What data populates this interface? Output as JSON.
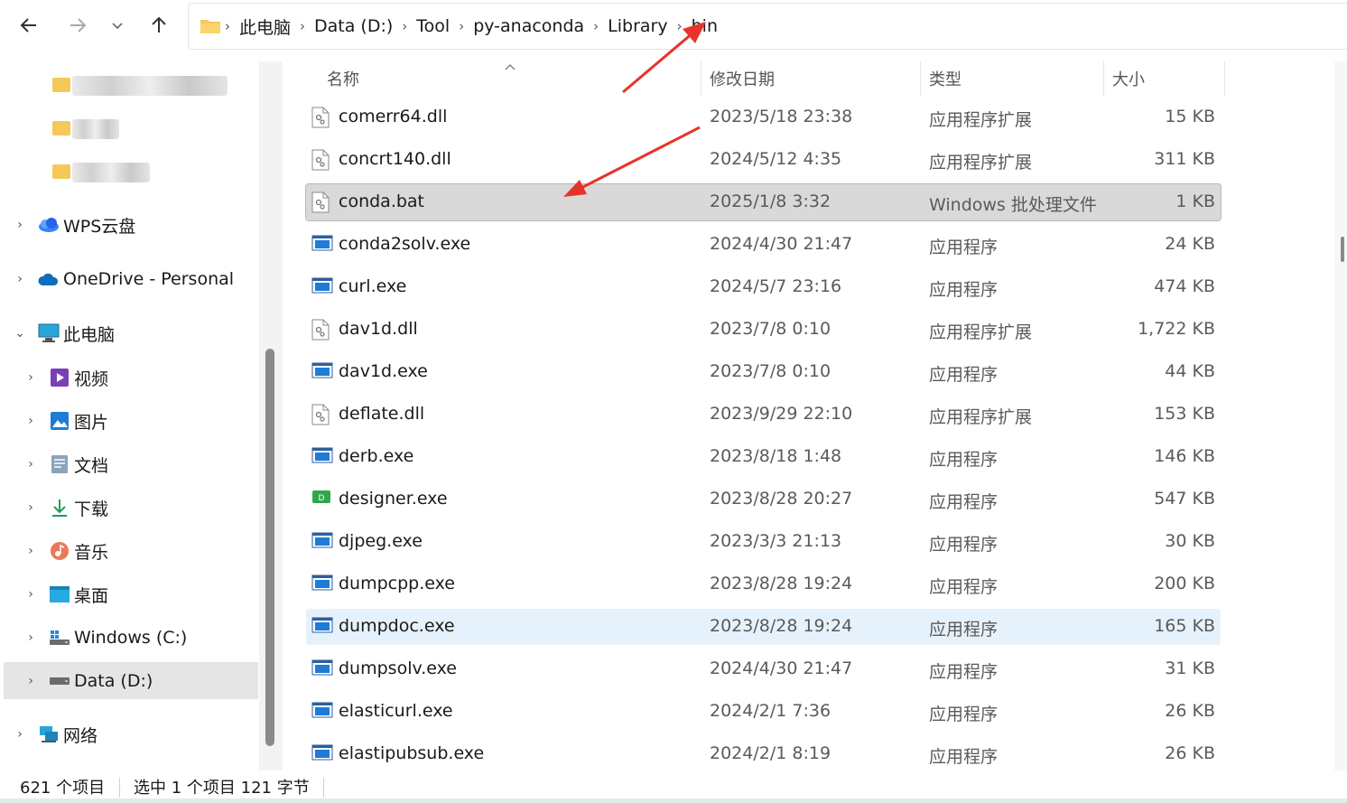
{
  "nav": {
    "back_icon": "arrow-left-icon",
    "forward_icon": "arrow-right-icon",
    "recent_icon": "chevron-down-icon",
    "up_icon": "arrow-up-icon"
  },
  "address": {
    "crumbs": [
      "此电脑",
      "Data (D:)",
      "Tool",
      "py-anaconda",
      "Library",
      "bin"
    ]
  },
  "sidebar": {
    "items": [
      {
        "label": "WPS云盘",
        "icon": "wps-cloud-icon"
      },
      {
        "label": "OneDrive - Personal",
        "icon": "onedrive-cloud-icon"
      },
      {
        "label": "此电脑",
        "icon": "computer-icon"
      },
      {
        "label": "视频",
        "icon": "video-folder-icon"
      },
      {
        "label": "图片",
        "icon": "pictures-folder-icon"
      },
      {
        "label": "文档",
        "icon": "documents-folder-icon"
      },
      {
        "label": "下载",
        "icon": "download-icon"
      },
      {
        "label": "音乐",
        "icon": "music-icon"
      },
      {
        "label": "桌面",
        "icon": "desktop-icon"
      },
      {
        "label": "Windows (C:)",
        "icon": "windows-drive-icon"
      },
      {
        "label": "Data (D:)",
        "icon": "drive-icon"
      },
      {
        "label": "网络",
        "icon": "network-icon"
      }
    ]
  },
  "columns": {
    "name": "名称",
    "date": "修改日期",
    "type": "类型",
    "size": "大小"
  },
  "files": [
    {
      "name": "comerr64.dll",
      "date": "2023/5/18 23:38",
      "type": "应用程序扩展",
      "size": "15 KB",
      "icon": "dll-icon"
    },
    {
      "name": "concrt140.dll",
      "date": "2024/5/12 4:35",
      "type": "应用程序扩展",
      "size": "311 KB",
      "icon": "dll-icon"
    },
    {
      "name": "conda.bat",
      "date": "2025/1/8 3:32",
      "type": "Windows 批处理文件",
      "size": "1 KB",
      "icon": "bat-icon"
    },
    {
      "name": "conda2solv.exe",
      "date": "2024/4/30 21:47",
      "type": "应用程序",
      "size": "24 KB",
      "icon": "exe-icon"
    },
    {
      "name": "curl.exe",
      "date": "2024/5/7 23:16",
      "type": "应用程序",
      "size": "474 KB",
      "icon": "exe-icon"
    },
    {
      "name": "dav1d.dll",
      "date": "2023/7/8 0:10",
      "type": "应用程序扩展",
      "size": "1,722 KB",
      "icon": "dll-icon"
    },
    {
      "name": "dav1d.exe",
      "date": "2023/7/8 0:10",
      "type": "应用程序",
      "size": "44 KB",
      "icon": "exe-icon"
    },
    {
      "name": "deflate.dll",
      "date": "2023/9/29 22:10",
      "type": "应用程序扩展",
      "size": "153 KB",
      "icon": "dll-icon"
    },
    {
      "name": "derb.exe",
      "date": "2023/8/18 1:48",
      "type": "应用程序",
      "size": "146 KB",
      "icon": "exe-icon"
    },
    {
      "name": "designer.exe",
      "date": "2023/8/28 20:27",
      "type": "应用程序",
      "size": "547 KB",
      "icon": "designer-icon"
    },
    {
      "name": "djpeg.exe",
      "date": "2023/3/3 21:13",
      "type": "应用程序",
      "size": "30 KB",
      "icon": "exe-icon"
    },
    {
      "name": "dumpcpp.exe",
      "date": "2023/8/28 19:24",
      "type": "应用程序",
      "size": "200 KB",
      "icon": "exe-icon"
    },
    {
      "name": "dumpdoc.exe",
      "date": "2023/8/28 19:24",
      "type": "应用程序",
      "size": "165 KB",
      "icon": "exe-icon"
    },
    {
      "name": "dumpsolv.exe",
      "date": "2024/4/30 21:47",
      "type": "应用程序",
      "size": "31 KB",
      "icon": "exe-icon"
    },
    {
      "name": "elasticurl.exe",
      "date": "2024/2/1 7:36",
      "type": "应用程序",
      "size": "26 KB",
      "icon": "exe-icon"
    },
    {
      "name": "elastipubsub.exe",
      "date": "2024/2/1 8:19",
      "type": "应用程序",
      "size": "26 KB",
      "icon": "exe-icon"
    }
  ],
  "status": {
    "count": "621 个项目",
    "selection": "选中 1 个项目  121 字节"
  },
  "colors": {
    "selected_row": "#d9d9d9",
    "hover_row": "#e6f2fb",
    "annotation_arrow": "#e8332a",
    "folder": "#f5c85a"
  }
}
